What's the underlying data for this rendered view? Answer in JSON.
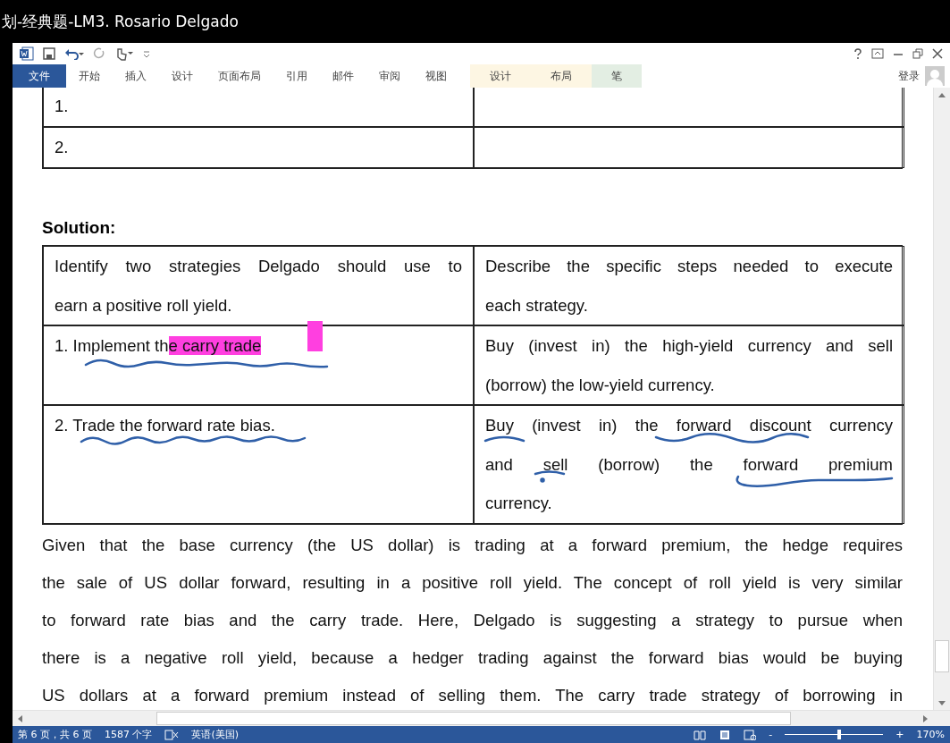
{
  "window": {
    "title": "划-经典题-LM3. Rosario Delgado"
  },
  "quick_access": {
    "account": "登录"
  },
  "ribbon_tabs": [
    {
      "label": "文件",
      "selected": true,
      "kind": "file"
    },
    {
      "label": "开始",
      "selected": false,
      "kind": "normal"
    },
    {
      "label": "插入",
      "selected": false,
      "kind": "normal"
    },
    {
      "label": "设计",
      "selected": false,
      "kind": "normal"
    },
    {
      "label": "页面布局",
      "selected": false,
      "kind": "normal"
    },
    {
      "label": "引用",
      "selected": false,
      "kind": "normal"
    },
    {
      "label": "邮件",
      "selected": false,
      "kind": "normal"
    },
    {
      "label": "审阅",
      "selected": false,
      "kind": "normal"
    },
    {
      "label": "视图",
      "selected": false,
      "kind": "normal"
    },
    {
      "label": "设计",
      "selected": false,
      "kind": "contextual",
      "color": "#fdf6e3"
    },
    {
      "label": "布局",
      "selected": false,
      "kind": "contextual",
      "color": "#fdf6e3"
    },
    {
      "label": "笔",
      "selected": false,
      "kind": "contextual",
      "color": "#e3eee3"
    }
  ],
  "document": {
    "top_table": {
      "rows": [
        [
          "1.",
          ""
        ],
        [
          "2.",
          ""
        ]
      ]
    },
    "heading": "Solution:",
    "solution_table": {
      "rows": [
        [
          {
            "lines": [
              "Identify two strategies Delgado should use to",
              "earn a positive roll yield."
            ]
          },
          {
            "lines": [
              "Describe the specific steps needed to execute",
              "each strategy."
            ]
          }
        ],
        [
          {
            "segments": [
              {
                "text": "1. Implement th",
                "highlight": false
              },
              {
                "text": "e carry trade",
                "highlight": true
              }
            ]
          },
          {
            "lines": [
              "Buy (invest in) the high-yield currency and sell",
              "(borrow) the low-yield currency."
            ]
          }
        ],
        [
          {
            "lines": [
              "2. Trade the forward rate bias."
            ]
          },
          {
            "lines": [
              "Buy (invest in) the forward discount currency",
              "and sell (borrow) the forward premium",
              "currency."
            ]
          }
        ]
      ]
    },
    "paragraph_lines": [
      "Given that the base currency (the US dollar) is trading at a forward premium, the hedge requires",
      "the sale of US dollar forward, resulting in a positive roll yield. The concept of roll yield is very similar",
      "to forward rate bias and the carry trade. Here, Delgado is suggesting a strategy to pursue when",
      "there is a negative roll yield, because a hedger trading against the forward bias would be buying",
      "US dollars at a forward premium instead of selling them. The carry trade strategy of borrowing in"
    ]
  },
  "status_bar": {
    "page": "第 6 页，共 6 页",
    "words": "1587 个字",
    "language": "英语(美国)",
    "zoom": {
      "level": 0.55,
      "reading": "170%",
      "zoom_out": "-",
      "zoom_in": "+"
    }
  }
}
